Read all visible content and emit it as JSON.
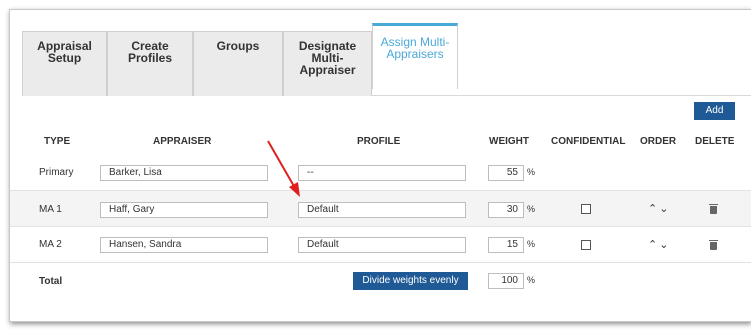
{
  "tabs": [
    {
      "label_1": "Appraisal Setup",
      "label_2": ""
    },
    {
      "label_1": "Create Profiles",
      "label_2": ""
    },
    {
      "label_1": "Groups",
      "label_2": ""
    },
    {
      "label_1": "Designate Multi-",
      "label_2": "Appraiser"
    },
    {
      "label_1": "Assign Multi-",
      "label_2": "Appraisers"
    }
  ],
  "add_label": "Add",
  "headers": {
    "type": "TYPE",
    "appraiser": "APPRAISER",
    "profile": "PROFILE",
    "weight": "WEIGHT",
    "confidential": "CONFIDENTIAL",
    "order": "ORDER",
    "delete": "DELETE"
  },
  "rows": [
    {
      "type": "Primary",
      "appraiser": "Barker, Lisa",
      "profile": "--",
      "weight": "55",
      "pct": "%"
    },
    {
      "type": "MA 1",
      "appraiser": "Haff, Gary",
      "profile": "Default",
      "weight": "30",
      "pct": "%",
      "order": "⌃⌄"
    },
    {
      "type": "MA 2",
      "appraiser": "Hansen, Sandra",
      "profile": "Default",
      "weight": "15",
      "pct": "%",
      "order": "⌃⌄"
    }
  ],
  "total": {
    "label": "Total",
    "weight": "100",
    "pct": "%"
  },
  "divide_label": "Divide weights evenly",
  "colors": {
    "accent": "#4aa8d8",
    "button": "#1f5a96",
    "arrow": "#e02020"
  }
}
